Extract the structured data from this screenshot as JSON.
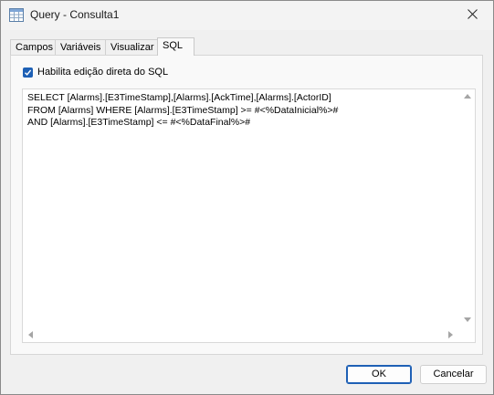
{
  "window": {
    "title": "Query - Consulta1",
    "icon": "table-grid-icon"
  },
  "tabs": [
    {
      "label": "Campos"
    },
    {
      "label": "Variáveis"
    },
    {
      "label": "Visualizar"
    },
    {
      "label": "SQL",
      "active": true
    }
  ],
  "sql_tab": {
    "checkbox_label": "Habilita edição direta do SQL",
    "checkbox_checked": true,
    "sql_text": "SELECT [Alarms].[E3TimeStamp],[Alarms].[AckTime],[Alarms].[ActorID]\nFROM [Alarms] WHERE [Alarms].[E3TimeStamp] >= #<%DataInicial%>#\nAND [Alarms].[E3TimeStamp] <= #<%DataFinal%>#"
  },
  "buttons": {
    "ok_label": "OK",
    "cancel_label": "Cancelar"
  },
  "colors": {
    "accent": "#1e60b5"
  }
}
